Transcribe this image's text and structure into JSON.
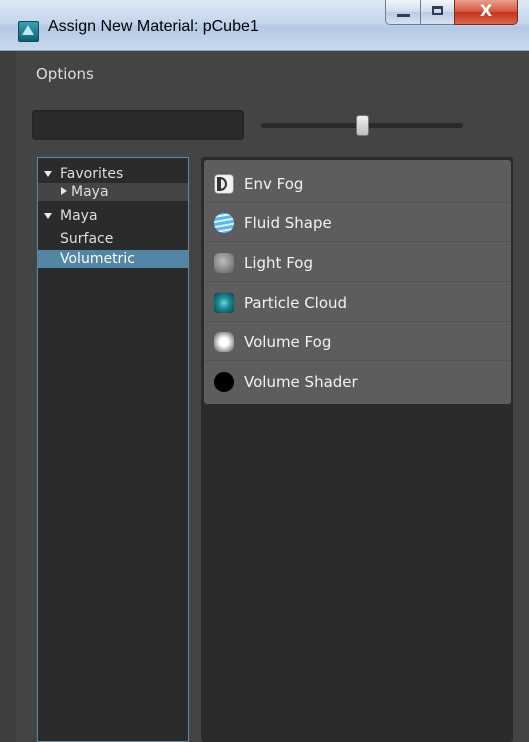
{
  "window": {
    "title": "Assign New Material: pCube1",
    "close_glyph": "X"
  },
  "menu": {
    "options": "Options"
  },
  "tree": {
    "items": [
      {
        "label": "Favorites",
        "expander": "expanded"
      },
      {
        "label": "Maya",
        "expander": "collapsed"
      },
      {
        "label": "Maya",
        "expander": "expanded"
      },
      {
        "label": "Surface",
        "expander": "none"
      },
      {
        "label": "Volumetric",
        "expander": "none",
        "selected": true
      }
    ]
  },
  "materials": {
    "items": [
      {
        "label": "Env Fog",
        "icon": "env-fog-icon"
      },
      {
        "label": "Fluid Shape",
        "icon": "fluid-shape-icon"
      },
      {
        "label": "Light Fog",
        "icon": "light-fog-icon"
      },
      {
        "label": "Particle Cloud",
        "icon": "particle-cloud-icon"
      },
      {
        "label": "Volume Fog",
        "icon": "volume-fog-icon"
      },
      {
        "label": "Volume Shader",
        "icon": "volume-shader-icon"
      }
    ]
  },
  "colors": {
    "selection": "#5285a6",
    "panel_bg": "#2b2b2b",
    "window_bg": "#444444"
  }
}
